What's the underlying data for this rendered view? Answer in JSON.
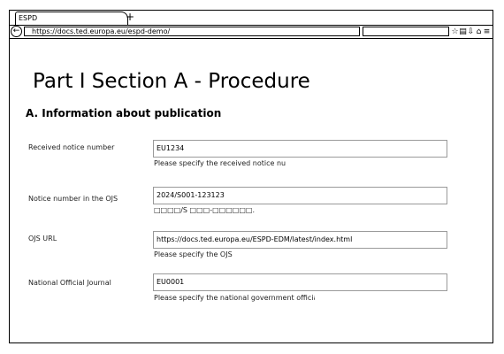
{
  "browser": {
    "tab_title": "ESPD",
    "new_tab": "+",
    "back": "←",
    "url": "https://docs.ted.europa.eu/espd-demo/",
    "search_value": "",
    "icons": {
      "bookmark": "☆",
      "reader": "▤",
      "download": "⇩",
      "home": "⌂",
      "menu": "≡"
    }
  },
  "page": {
    "title": "Part I Section A - Procedure",
    "section": "A. Information about publication"
  },
  "fields": [
    {
      "label": "Received notice number",
      "value": "EU1234",
      "help": "Please specify the received notice nu"
    },
    {
      "label": "Notice number in the OJS",
      "value": "2024/S001-123123",
      "help": "□□□□/S □□□-□□□□□□."
    },
    {
      "label": "OJS URL",
      "value": "https://docs.ted.europa.eu/ESPD-EDM/latest/index.html",
      "help": "Please specify the OJS"
    },
    {
      "label": "National Official Journal",
      "value": "EU0001",
      "help": "Please specify the national government officia"
    }
  ]
}
